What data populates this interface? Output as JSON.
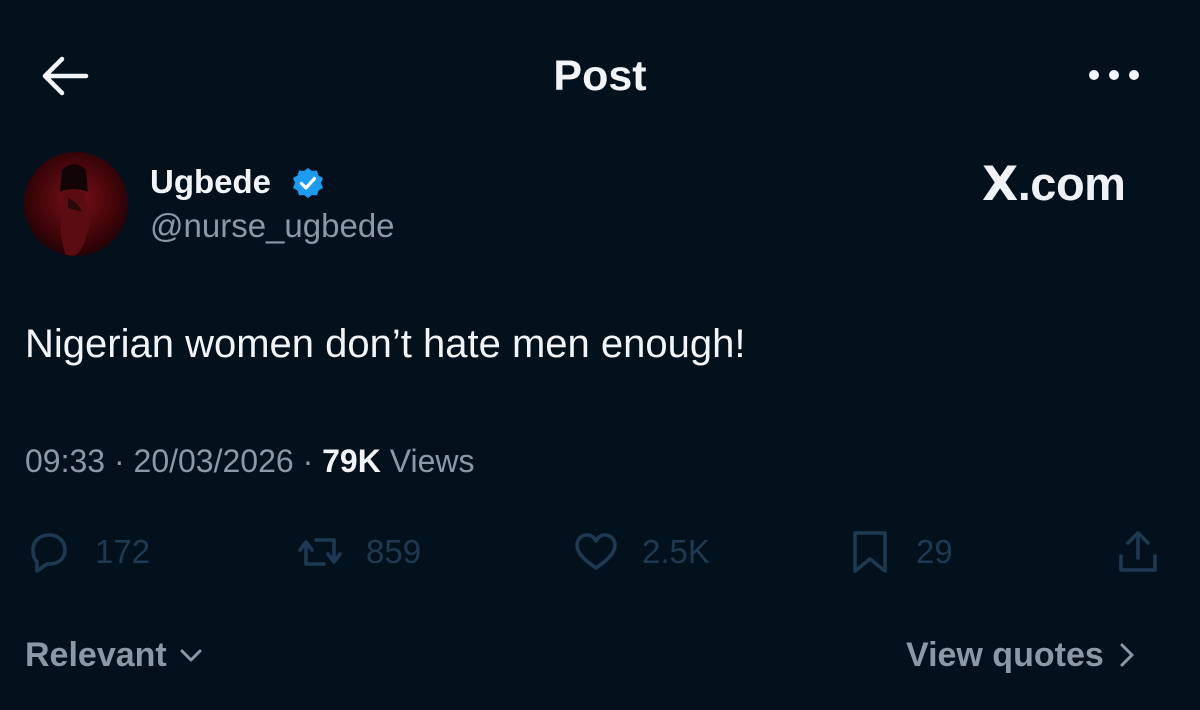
{
  "header": {
    "title": "Post",
    "back_icon": "arrow-left-icon",
    "more_icon": "more-horizontal-icon"
  },
  "author": {
    "display_name": "Ugbede",
    "handle": "@nurse_ugbede",
    "verified": true,
    "verified_color": "#1d9bf0"
  },
  "brand": {
    "x_letter": "X",
    "suffix": ".com"
  },
  "post": {
    "text": "Nigerian women don’t hate men enough!",
    "time": "09:33",
    "date": "20/03/2026",
    "separator": "·",
    "views_count": "79K",
    "views_label": "Views"
  },
  "actions": {
    "replies": "172",
    "reposts": "859",
    "likes": "2.5K",
    "bookmarks": "29"
  },
  "footer": {
    "sort_label": "Relevant",
    "view_quotes_label": "View quotes"
  },
  "colors": {
    "background": "#03111d",
    "primary_text": "#f2f5f7",
    "secondary_text": "#8b98a5",
    "action_dim": "#1e3a53"
  }
}
